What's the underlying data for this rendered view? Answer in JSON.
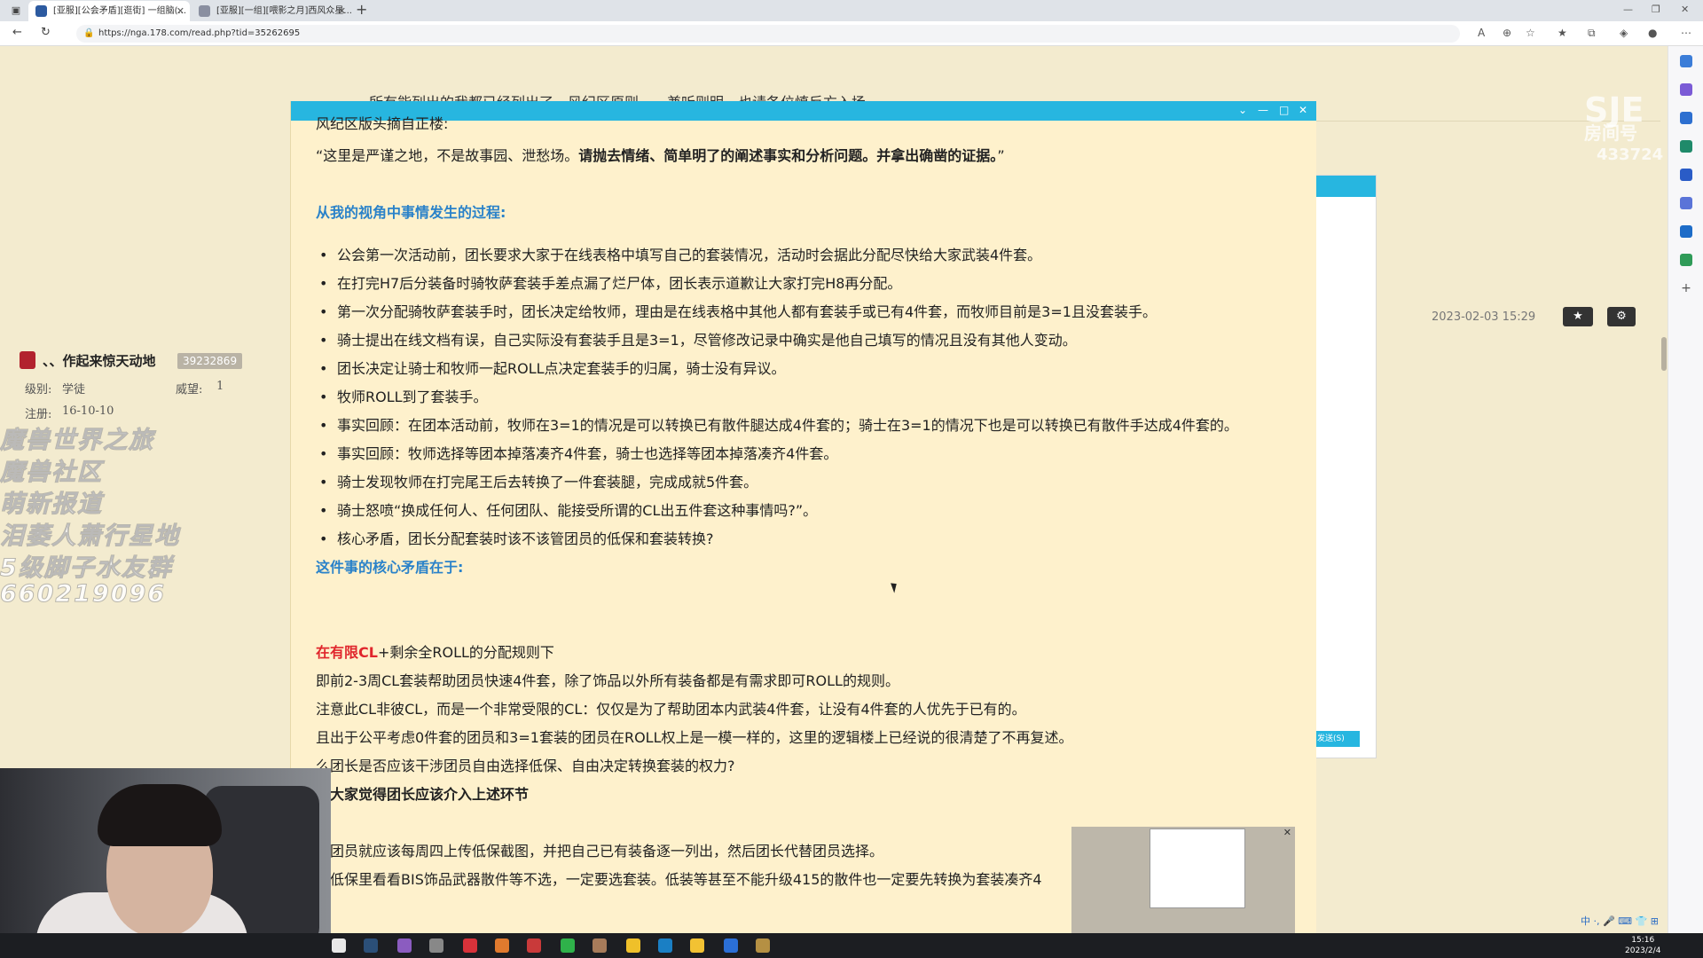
{
  "browser": {
    "tabs": [
      {
        "title": "[亚服][公会矛盾][逛街] 一组脑(...",
        "active": true
      },
      {
        "title": "[亚服][一组][喂影之月]西风众星...",
        "active": false
      }
    ],
    "url": "https://nga.178.com/read.php?tid=35262695"
  },
  "forum": {
    "notice_line": "所有能列出的我都已经列出了，风纪区原则——兼听则明，也请各位慎反方入场",
    "user": {
      "name": "、、作起来惊天动地",
      "id": "39232869",
      "level_label": "级别:",
      "level_value": "学徒",
      "prestige_label": "威望:",
      "prestige_value": "1",
      "register_label": "注册:",
      "register_value": "16-10-10"
    },
    "post_date": "2023-02-03 15:29",
    "fav_button": "★",
    "gear_button": "⚙"
  },
  "brand_watermark": {
    "line1": "SJE",
    "line2": "房间号",
    "line3": "433724"
  },
  "watermark": [
    "魔兽世界之旅",
    "魔兽社区",
    "萌新报道",
    "泪萎人萧行星地",
    "5级脚子水友群",
    "660219096"
  ],
  "doc": {
    "lines": [
      {
        "type": "partial",
        "text": "风纪区版头摘自正楼:"
      },
      {
        "type": "quote",
        "plain": "“这里是严谨之地，不是故事园、泄愁场。",
        "bold": "请抛去情绪、简单明了的阐述事实和分析问题。并拿出确凿的证据。",
        "tail": "”"
      },
      {
        "type": "head",
        "text": "从我的视角中事情发生的过程:"
      },
      {
        "type": "bullet",
        "text": "公会第一次活动前，团长要求大家于在线表格中填写自己的套装情况，活动时会据此分配尽快给大家武装4件套。"
      },
      {
        "type": "bullet",
        "text": "在打完H7后分装备时骑牧萨套装手差点漏了烂尸体，团长表示道歉让大家打完H8再分配。"
      },
      {
        "type": "bullet",
        "text": "第一次分配骑牧萨套装手时，团长决定给牧师，理由是在线表格中其他人都有套装手或已有4件套，而牧师目前是3=1且没套装手。"
      },
      {
        "type": "bullet",
        "text": "骑士提出在线文档有误，自己实际没有套装手且是3=1，尽管修改记录中确实是他自己填写的情况且没有其他人变动。"
      },
      {
        "type": "bullet",
        "text": "团长决定让骑士和牧师一起ROLL点决定套装手的归属，骑士没有异议。"
      },
      {
        "type": "bullet",
        "text": "牧师ROLL到了套装手。"
      },
      {
        "type": "bullet",
        "text": "事实回顾：在团本活动前，牧师在3=1的情况是可以转换已有散件腿达成4件套的；骑士在3=1的情况下也是可以转换已有散件手达成4件套的。"
      },
      {
        "type": "bullet",
        "text": "事实回顾：牧师选择等团本掉落凑齐4件套，骑士也选择等团本掉落凑齐4件套。"
      },
      {
        "type": "bullet",
        "text": "骑士发现牧师在打完尾王后去转换了一件套装腿，完成成就5件套。"
      },
      {
        "type": "bullet",
        "text": "骑士怒喷“换成任何人、任何团队、能接受所谓的CL出五件套这种事情吗?”。"
      },
      {
        "type": "bullet",
        "text": "核心矛盾，团长分配套装时该不该管团员的低保和套装转换?"
      },
      {
        "type": "head",
        "text": "这件事的核心矛盾在于:"
      },
      {
        "type": "red",
        "red": "在有限CL",
        "tail": "+剩余全ROLL的分配规则下"
      },
      {
        "type": "plain",
        "text": "即前2-3周CL套装帮助团员快速4件套，除了饰品以外所有装备都是有需求即可ROLL的规则。"
      },
      {
        "type": "plain",
        "text": "注意此CL非彼CL，而是一个非常受限的CL：仅仅是为了帮助团本内武装4件套，让没有4件套的人优先于已有的。"
      },
      {
        "type": "plain",
        "text": "且出于公平考虑0件套的团员和3=1套装的团员在ROLL权上是一模一样的，这里的逻辑楼上已经说的很清楚了不再复述。"
      },
      {
        "type": "plain",
        "text": "么团长是否应该干涉团员自由选择低保、自由决定转换套装的权力?"
      },
      {
        "type": "bold",
        "text": "果大家觉得团长应该介入上述环节"
      },
      {
        "type": "plain",
        "text": "么团员就应该每周四上传低保截图，并把自己已有装备逐一列出，然后团长代替团员选择。"
      },
      {
        "type": "plain",
        "text": "如低保里看看BIS饰品武器散件等不选，一定要选套装。低装等甚至不能升级415的散件也一定要先转换为套装凑齐4"
      }
    ]
  },
  "popup2": {
    "send_label": "发送(S)"
  },
  "taskbar": {
    "time": "15:16",
    "date": "2023/2/4"
  },
  "ime": {
    "text": "中 ·, 🎤 ⌨ 👕 ⊞"
  }
}
